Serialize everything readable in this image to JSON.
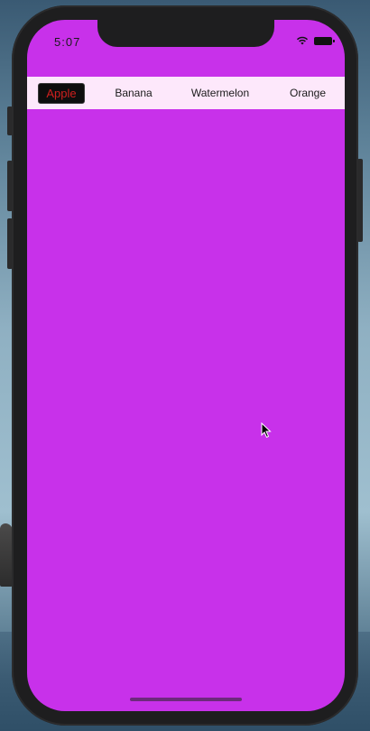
{
  "status_bar": {
    "time": "5:07",
    "icons": [
      "wifi-icon",
      "battery-icon"
    ]
  },
  "tabs": [
    {
      "label": "Apple",
      "selected": true
    },
    {
      "label": "Banana",
      "selected": false
    },
    {
      "label": "Watermelon",
      "selected": false
    },
    {
      "label": "Orange",
      "selected": false
    }
  ],
  "colors": {
    "screen_background": "#c831ea",
    "tabbar_background": "#fde8fb",
    "selected_tab_background": "#0e0e0e",
    "selected_tab_text": "#d0201e",
    "phone_frame": "#1e1e1f"
  }
}
